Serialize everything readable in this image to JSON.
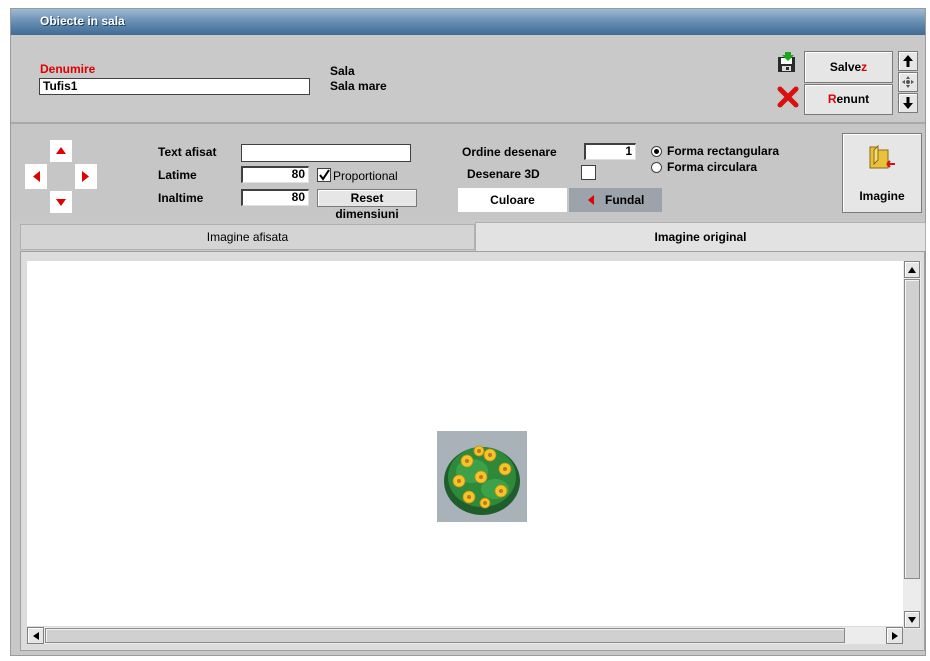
{
  "window": {
    "title": "Obiecte in sala"
  },
  "header": {
    "denumire_label": "Denumire",
    "denumire_value": "Tufis1",
    "sala_label": "Sala",
    "sala_value": "Sala mare"
  },
  "actions": {
    "save_prefix": "Salve",
    "save_hotkey": "z",
    "cancel_hotkey": "R",
    "cancel_suffix": "enunt",
    "save_icon": "save-floppy-icon",
    "cancel_icon": "red-x-icon"
  },
  "props": {
    "text_afisat_label": "Text afisat",
    "text_afisat_value": "",
    "latime_label": "Latime",
    "latime_value": "80",
    "inaltime_label": "Inaltime",
    "inaltime_value": "80",
    "proportional_label": "Proportional",
    "proportional_checked": true,
    "reset_label": "Reset dimensiuni",
    "ordine_label": "Ordine desenare",
    "ordine_value": "1",
    "desenare3d_label": "Desenare 3D",
    "desenare3d_checked": false,
    "forma_rect_label": "Forma rectangulara",
    "forma_circ_label": "Forma circulara",
    "forma_selected": "rectangulara",
    "culoare_label": "Culoare",
    "fundal_label": "Fundal",
    "imagine_label": "Imagine"
  },
  "tabs": [
    {
      "label": "Imagine afisata",
      "active": false
    },
    {
      "label": "Imagine original",
      "active": true
    }
  ],
  "colors": {
    "title_gradient_top": "#9fbad3",
    "title_gradient_bottom": "#3f6b95",
    "accent_red": "#e00000",
    "panel_gray": "#c9c9c9"
  }
}
